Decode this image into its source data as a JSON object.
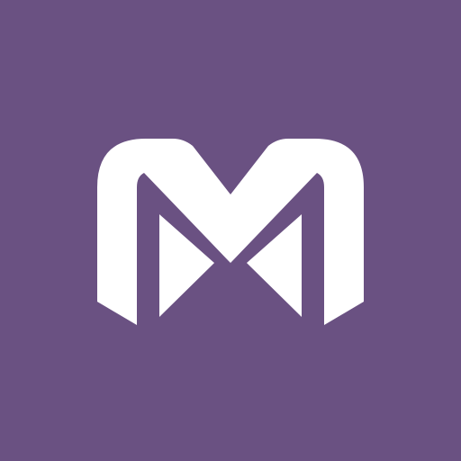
{
  "icon": {
    "name": "m-logo-icon",
    "background_color": "#6a5182",
    "foreground_color": "#ffffff"
  }
}
